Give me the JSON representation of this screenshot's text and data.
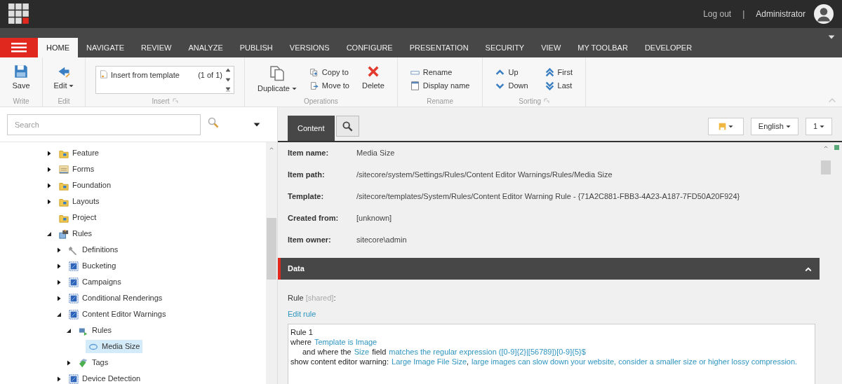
{
  "header": {
    "logout": "Log out",
    "separator": "|",
    "user": "Administrator"
  },
  "tabs": [
    {
      "label": "HOME",
      "selected": true
    },
    {
      "label": "NAVIGATE",
      "selected": false
    },
    {
      "label": "REVIEW",
      "selected": false
    },
    {
      "label": "ANALYZE",
      "selected": false
    },
    {
      "label": "PUBLISH",
      "selected": false
    },
    {
      "label": "VERSIONS",
      "selected": false
    },
    {
      "label": "CONFIGURE",
      "selected": false
    },
    {
      "label": "PRESENTATION",
      "selected": false
    },
    {
      "label": "SECURITY",
      "selected": false
    },
    {
      "label": "VIEW",
      "selected": false
    },
    {
      "label": "MY TOOLBAR",
      "selected": false
    },
    {
      "label": "DEVELOPER",
      "selected": false
    }
  ],
  "ribbon": [
    {
      "label": "Write",
      "kind": "large",
      "buttons": [
        {
          "label": "Save",
          "kind": "save",
          "dropdown": false
        }
      ]
    },
    {
      "label": "Edit",
      "kind": "large",
      "buttons": [
        {
          "label": "Edit",
          "kind": "edit",
          "dropdown": true
        }
      ]
    },
    {
      "label": "Insert",
      "kind": "gallery",
      "expand": true,
      "item": "Insert from template",
      "count": "(1 of 1)"
    },
    {
      "label": "Operations",
      "kind": "mixed",
      "buttons": [
        {
          "label": "Duplicate",
          "kind": "duplicate",
          "dropdown": true
        },
        {
          "label": "Copy to",
          "kind": "copy"
        },
        {
          "label": "Move to",
          "kind": "move"
        },
        {
          "label": "Delete",
          "kind": "delete",
          "dropdown": false
        }
      ]
    },
    {
      "label": "Rename",
      "kind": "small",
      "buttons": [
        {
          "label": "Rename",
          "kind": "rename"
        },
        {
          "label": "Display name",
          "kind": "display"
        }
      ]
    },
    {
      "label": "Sorting",
      "kind": "small",
      "expand": true,
      "buttons": [
        {
          "label": "Up",
          "kind": "up"
        },
        {
          "label": "Down",
          "kind": "down"
        },
        {
          "label": "First",
          "kind": "first"
        },
        {
          "label": "Last",
          "kind": "last"
        }
      ]
    }
  ],
  "search": {
    "placeholder": "Search"
  },
  "tree": [
    {
      "label": "Feature",
      "kind": "folder",
      "expanded": false,
      "selected": false
    },
    {
      "label": "Forms",
      "kind": "forms",
      "expanded": false,
      "selected": false
    },
    {
      "label": "Foundation",
      "kind": "folder",
      "expanded": false,
      "selected": false
    },
    {
      "label": "Layouts",
      "kind": "folder",
      "expanded": false,
      "selected": false
    },
    {
      "label": "Project",
      "kind": "folder",
      "selected": false
    },
    {
      "label": "Rules",
      "kind": "rules",
      "expanded": true,
      "selected": false,
      "children": [
        {
          "label": "Definitions",
          "kind": "wrench",
          "expanded": false,
          "selected": false
        },
        {
          "label": "Bucketing",
          "kind": "template",
          "expanded": false,
          "selected": false
        },
        {
          "label": "Campaigns",
          "kind": "template",
          "expanded": false,
          "selected": false
        },
        {
          "label": "Conditional Renderings",
          "kind": "template",
          "expanded": false,
          "selected": false
        },
        {
          "label": "Content Editor Warnings",
          "kind": "template",
          "expanded": true,
          "selected": false,
          "children": [
            {
              "label": "Rules",
              "kind": "rulefolder",
              "expanded": true,
              "selected": false,
              "children": [
                {
                  "label": "Media Size",
                  "kind": "rule",
                  "selected": true
                }
              ]
            },
            {
              "label": "Tags",
              "kind": "tags",
              "expanded": false,
              "selected": false
            }
          ]
        },
        {
          "label": "Device Detection",
          "kind": "template",
          "expanded": false,
          "selected": false
        }
      ]
    }
  ],
  "editor_tabs": [
    {
      "label": "Content",
      "kind": "text",
      "selected": true
    },
    {
      "kind": "search",
      "selected": false
    }
  ],
  "editor_controls": [
    {
      "kind": "icon"
    },
    {
      "kind": "text",
      "label": "English"
    },
    {
      "kind": "text",
      "label": "1"
    }
  ],
  "fields": [
    {
      "label": "Item name:",
      "value": "Media Size"
    },
    {
      "label": "Item path:",
      "value": "/sitecore/system/Settings/Rules/Content Editor Warnings/Rules/Media Size"
    },
    {
      "label": "Template:",
      "value": "/sitecore/templates/System/Rules/Content Editor Warning Rule - {71A2C881-FBB3-4A23-A187-7FD50A20F924}"
    },
    {
      "label": "Created from:",
      "value": "[unknown]"
    },
    {
      "label": "Item owner:",
      "value": "sitecore\\admin"
    }
  ],
  "section": {
    "title": "Data",
    "expanded": true,
    "field_label": "Rule",
    "field_note": "[shared]",
    "field_colon": ":",
    "edit_link": "Edit rule",
    "rule_lines": [
      {
        "indent": false,
        "parts": [
          {
            "text": "Rule 1",
            "link": false
          }
        ]
      },
      {
        "indent": false,
        "parts": [
          {
            "text": "where",
            "link": false
          },
          {
            "text": "Template is Image",
            "link": true
          }
        ]
      },
      {
        "indent": true,
        "parts": [
          {
            "text": "and where the",
            "link": false
          },
          {
            "text": "Size",
            "link": true
          },
          {
            "text": "field",
            "link": false
          },
          {
            "text": "matches the regular expression ([0-9]{2}|[56789])[0-9]{5}$",
            "link": true
          }
        ]
      },
      {
        "indent": false,
        "parts": [
          {
            "text": "show content editor warning:",
            "link": false
          },
          {
            "text": "Large Image File Size",
            "link": true
          },
          {
            "text": ",",
            "link": false,
            "attach": true
          },
          {
            "text": "large images can slow down your website, consider a smaller size or higher lossy compression.",
            "link": true
          }
        ]
      }
    ]
  }
}
